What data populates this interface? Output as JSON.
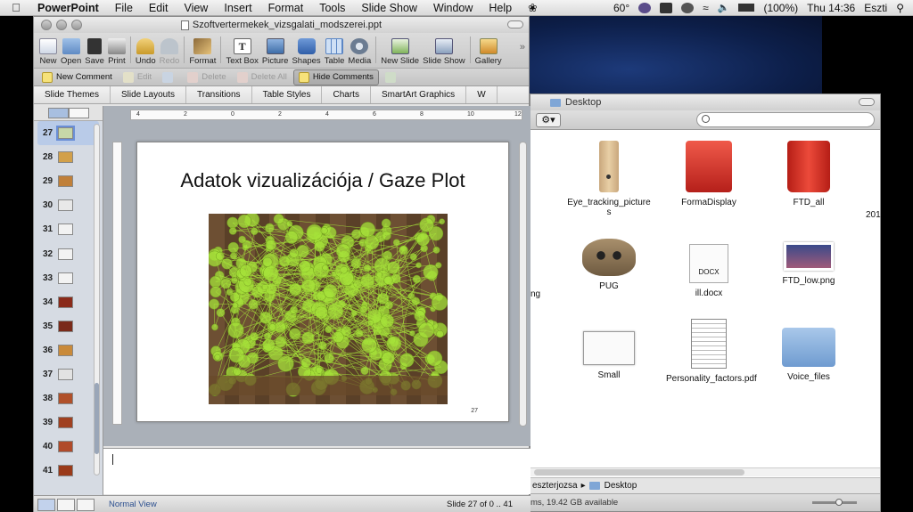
{
  "menubar": {
    "app": "PowerPoint",
    "items": [
      "File",
      "Edit",
      "View",
      "Insert",
      "Format",
      "Tools",
      "Slide Show",
      "Window",
      "Help"
    ],
    "temperature": "60°",
    "battery": "(100%)",
    "clock": "Thu 14:36",
    "user": "Eszti"
  },
  "ppt": {
    "window_title": "Szoftvertermekek_vizsgalati_modszerei.ppt",
    "toolbar": {
      "new": "New",
      "open": "Open",
      "save": "Save",
      "print": "Print",
      "undo": "Undo",
      "redo": "Redo",
      "format": "Format",
      "text_box": "Text Box",
      "picture": "Picture",
      "shapes": "Shapes",
      "table": "Table",
      "media": "Media",
      "new_slide": "New Slide",
      "slide_show": "Slide Show",
      "gallery": "Gallery"
    },
    "comments": {
      "new_comment": "New Comment",
      "edit": "Edit",
      "delete": "Delete",
      "delete_all": "Delete All",
      "hide_comments": "Hide Comments"
    },
    "ribbon_tabs": [
      "Slide Themes",
      "Slide Layouts",
      "Transitions",
      "Table Styles",
      "Charts",
      "SmartArt Graphics",
      "W"
    ],
    "ruler_marks": [
      "4",
      "2",
      "0",
      "2",
      "4",
      "6",
      "8",
      "10",
      "12"
    ],
    "thumbnails": [
      "27",
      "28",
      "29",
      "30",
      "31",
      "32",
      "33",
      "34",
      "35",
      "36",
      "37",
      "38",
      "39",
      "40",
      "41"
    ],
    "selected_thumbnail": "27",
    "slide": {
      "title": "Adatok vizualizációja / Gaze Plot",
      "number": "27"
    },
    "status": {
      "view": "Normal View",
      "slide_count": "Slide 27 of 0 .. 41"
    }
  },
  "finder": {
    "title": "Desktop",
    "items": [
      {
        "label": "Eye_tracking_pictures",
        "icon": "zipper-folder-icon"
      },
      {
        "label": "FormaDisplay",
        "icon": "red-box-icon"
      },
      {
        "label": "FTD_all",
        "icon": "trash-can-icon"
      },
      {
        "label": "PUG",
        "icon": "pug-icon"
      },
      {
        "label": "ill.docx",
        "icon": "docx-icon"
      },
      {
        "label": "FTD_low.png",
        "icon": "png-thumbnail-icon"
      },
      {
        "label": "Small",
        "icon": "window-thumbnail-icon"
      },
      {
        "label": "Personality_factors.pdf",
        "icon": "pdf-icon"
      },
      {
        "label": "Voice_files",
        "icon": "folder-icon"
      }
    ],
    "clipped_labels": [
      "201",
      "ng"
    ],
    "path": [
      "eszterjozsa",
      "Desktop"
    ],
    "status": "ms, 19.42 GB available"
  },
  "colors": {
    "gaze_fill": "#a6e23a",
    "selection_blue": "#b9cbe8",
    "folder_blue": "#7fa6d6",
    "trash_red": "#d9342a"
  }
}
